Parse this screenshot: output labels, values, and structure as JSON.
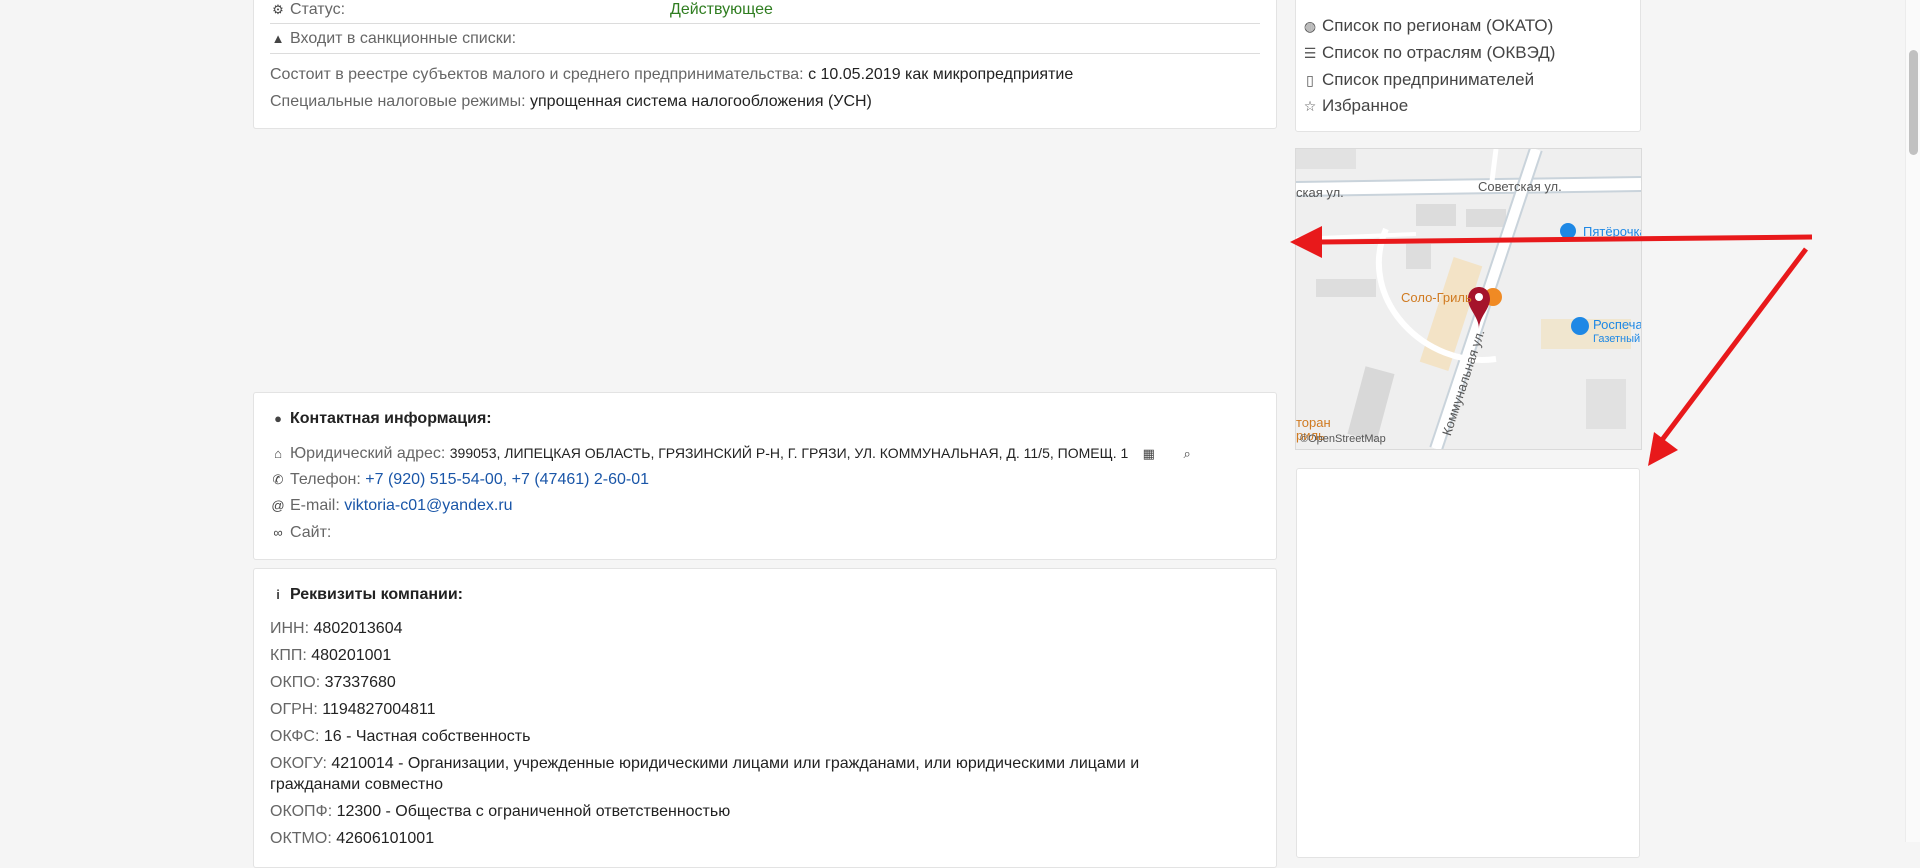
{
  "status_card": {
    "status_label": "Статус:",
    "status_value": "Действующее",
    "sanctions_label": "Входит в санкционные списки:",
    "msp_label": "Состоит в реестре субъектов малого и среднего предпринимательства:",
    "msp_value": "с 10.05.2019 как микропредприятие",
    "tax_label": "Специальные налоговые режимы:",
    "tax_value": "упрощенная система налогообложения (УСН)"
  },
  "sidebar": {
    "links": [
      {
        "label": "Список по регионам (ОКАТО)",
        "icon": "globe-icon"
      },
      {
        "label": "Список по отраслям (ОКВЭД)",
        "icon": "list-icon"
      },
      {
        "label": "Список предпринимателей",
        "icon": "address-book-icon"
      },
      {
        "label": "Избранное",
        "icon": "star-icon"
      }
    ]
  },
  "map": {
    "street_top_left": "ская ул.",
    "street_top": "Советская ул.",
    "street_diag": "Коммунальная ул.",
    "poi_shop": "Пятёрочка",
    "poi_cafe": "Соло-Гриль",
    "poi_kiosk": "Роспечать",
    "poi_kiosk_sub": "Газетный",
    "poi_bottom_left_1": "торан",
    "poi_bottom_left_2": "риль",
    "attribution": "©OpenStreetMap"
  },
  "contacts": {
    "heading": "Контактная информация:",
    "address_label": "Юридический адрес:",
    "address_value": "399053, ЛИПЕЦКАЯ ОБЛАСТЬ, ГРЯЗИНСКИЙ Р-Н, Г. ГРЯЗИ, УЛ. КОММУНАЛЬНАЯ, Д. 11/5, ПОМЕЩ. 1",
    "phone_label": "Телефон:",
    "phone_1": "+7 (920) 515-54-00",
    "phone_sep": ",",
    "phone_2": "+7 (47461) 2-60-01",
    "email_label": "E-mail:",
    "email_value": "viktoria-c01@yandex.ru",
    "site_label": "Сайт:"
  },
  "requisites": {
    "heading": "Реквизиты компании:",
    "items": [
      {
        "label": "ИНН:",
        "value": "4802013604"
      },
      {
        "label": "КПП:",
        "value": "480201001"
      },
      {
        "label": "ОКПО:",
        "value": "37337680"
      },
      {
        "label": "ОГРН:",
        "value": "1194827004811"
      },
      {
        "label": "ОКФС:",
        "value": "16 - Частная собственность"
      },
      {
        "label": "ОКОГУ:",
        "value": "4210014 - Организации, учрежденные юридическими лицами или гражданами, или юридическими лицами и",
        "value2": "гражданами совместно"
      },
      {
        "label": "ОКОПФ:",
        "value": "12300 - Общества с ограниченной ответственностью"
      },
      {
        "label": "ОКТМО:",
        "value": "42606101001"
      }
    ]
  },
  "colors": {
    "status_green": "#2f7d20",
    "link_blue": "#1a56a8",
    "arrow_red": "#e8191b",
    "map_pin": "#a5132b"
  }
}
